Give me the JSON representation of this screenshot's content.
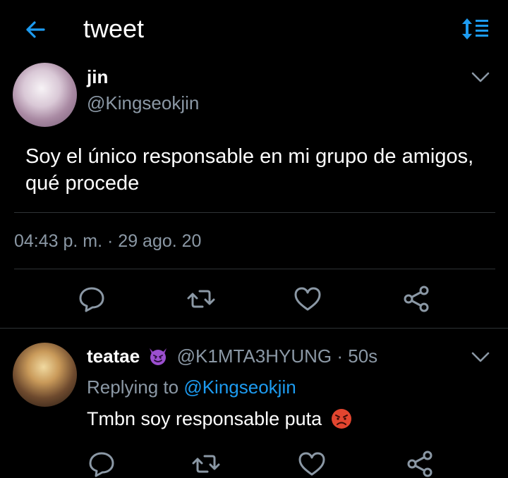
{
  "header": {
    "title": "tweet"
  },
  "tweet": {
    "author_name": "jin",
    "author_handle": "@Kingseokjin",
    "text": "Soy el único responsable en mi grupo de amigos, qué procede",
    "timestamp": "04:43 p. m. · 29 ago. 20"
  },
  "reply": {
    "author_name": "teatae",
    "author_handle": "@K1MTA3HYUNG",
    "time": "· 50s",
    "replying_prefix": "Replying to",
    "replying_mention": "@Kingseokjin",
    "text": "Tmbn soy responsable puta"
  },
  "icons": {
    "back": "arrow-left-icon",
    "sort": "sort-icon",
    "more": "chevron-down-icon",
    "reply": "reply-icon",
    "retweet": "retweet-icon",
    "like": "heart-icon",
    "share": "share-icon"
  },
  "colors": {
    "accent": "#1d9bf0",
    "muted": "#8b98a5",
    "divider": "#2f3336",
    "background": "#000000"
  }
}
